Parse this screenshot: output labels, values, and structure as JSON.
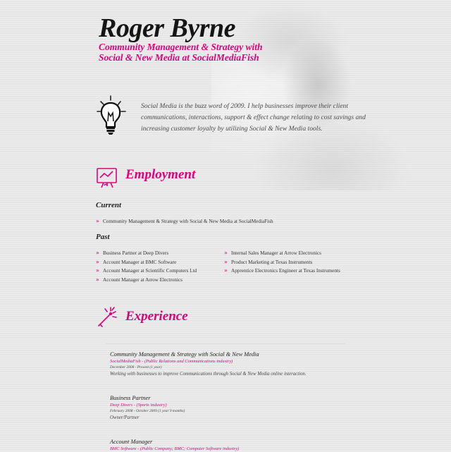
{
  "header": {
    "name": "Roger Byrne",
    "tagline": "Community Management & Strategy with Social & New Media at SocialMediaFish"
  },
  "intro": {
    "icon": "lightbulb-icon",
    "text": "Social Media is the buzz word of 2009. I help businesses improve their client communications, interactions, support & effect change relating to cost savings and increasing customer loyalty by utilizing Social & New Media tools."
  },
  "employment": {
    "title": "Employment",
    "icon": "presentation-board-icon",
    "current_label": "Current",
    "current": [
      "Community Management & Strategy with Social & New Media at SocialMediaFish"
    ],
    "past_label": "Past",
    "past_left": [
      "Business Partner at Deep Divers",
      "Account Manager at BMC Software",
      "Account Manager at Scientific Computers Ltd",
      "Account Manager at Arrow Electronics"
    ],
    "past_right": [
      "Internal Sales Manager at Arrow Electronics",
      "Product Marketing at Texas Instruments",
      "Apprentice Electronics Engineer at Texas Instruments"
    ]
  },
  "experience": {
    "title": "Experience",
    "icon": "magic-wand-icon",
    "items": [
      {
        "role": "Community Management & Strategy with Social & New Media",
        "company": "SocialMediaFish - (Public Relations and Communications industry)",
        "dates": "December 2008 - Present (1 year)",
        "desc": "Working with businesses to improve Communications through Social & New Media online interaction."
      },
      {
        "role": "Business Partner",
        "company": "Deep Divers - (Sports industry)",
        "dates": "February 2008 - October 2009 (1 year 9 months)",
        "desc": "Owner/Partner"
      },
      {
        "role": "Account Manager",
        "company": "BMC Software - (Public Company; BMC; Computer Software industry)",
        "dates": "",
        "desc": ""
      }
    ]
  },
  "colors": {
    "accent": "#e0007a",
    "text": "#333333",
    "background": "#e9e9e9"
  }
}
